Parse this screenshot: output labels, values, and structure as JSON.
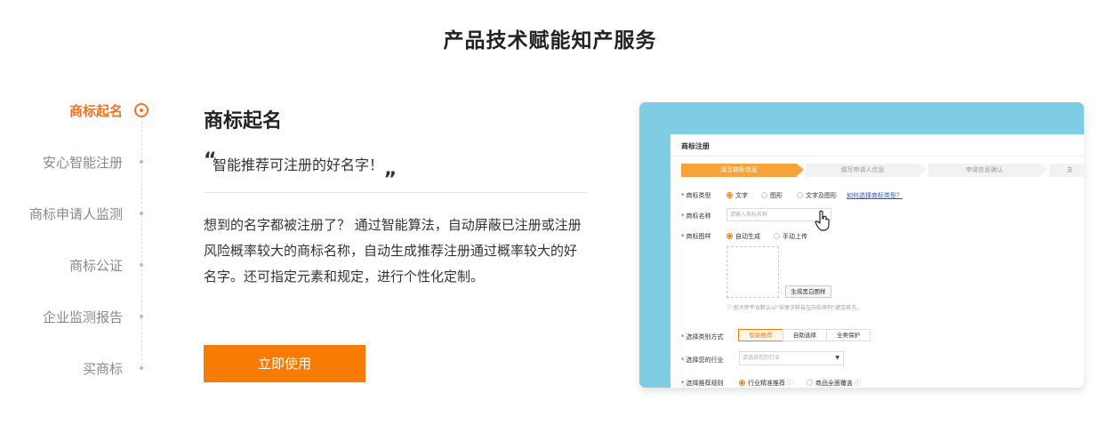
{
  "section": {
    "title": "产品技术赋能知产服务"
  },
  "nav": {
    "items": [
      {
        "label": "商标起名",
        "active": true
      },
      {
        "label": "安心智能注册",
        "active": false
      },
      {
        "label": "商标申请人监测",
        "active": false
      },
      {
        "label": "商标公证",
        "active": false
      },
      {
        "label": "企业监测报告",
        "active": false
      },
      {
        "label": "买商标",
        "active": false
      }
    ]
  },
  "feature": {
    "title": "商标起名",
    "quote": "智能推荐可注册的好名字！",
    "description": "想到的名字都被注册了？ 通过智能算法，自动屏蔽已注册或注册风险概率较大的商标名称，自动生成推荐注册通过概率较大的好名字。还可指定元素和规定，进行个性化定制。",
    "cta_label": "立即使用"
  },
  "preview": {
    "title": "商标注册",
    "steps": [
      "填写商标信息",
      "填写申请人信息",
      "申请信息确认",
      "支"
    ],
    "type_label": "商标类型",
    "type_options": [
      "文字",
      "图形",
      "文字及图形"
    ],
    "type_help_link": "如何选择商标类型？",
    "name_label": "商标名称",
    "name_placeholder": "请输入商标名称",
    "pattern_label": "商标图样",
    "pattern_options": [
      "自动生成",
      "手动上传"
    ],
    "generate_button": "生成黑白图样",
    "pattern_tip": "ⓘ 权大师平台默认以“宋体字样自左向右排列”递交官方。",
    "category_label": "选择类别方式",
    "category_options": [
      "智能推荐",
      "自助选择",
      "全类保护"
    ],
    "industry_label": "选择您的行业",
    "industry_placeholder": "请选择您的行业",
    "rule_label": "选择推荐规则",
    "rule_options": [
      "行业精准推荐",
      "商品全面覆盖"
    ],
    "colors": {
      "card_bg": "#7ecde3",
      "accent": "#f67c06"
    }
  }
}
